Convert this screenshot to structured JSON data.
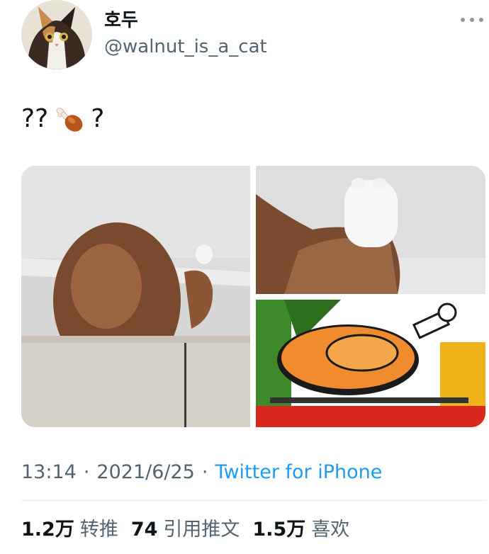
{
  "user": {
    "display_name": "호두",
    "handle": "@walnut_is_a_cat",
    "avatar_icon": "cat-avatar"
  },
  "tweet": {
    "text_before": "??",
    "emoji_icon": "poultry-leg-emoji",
    "text_after": "?"
  },
  "media": {
    "images": [
      "cat-back-photo",
      "cat-paw-closeup-photo",
      "cartoon-roast-turkey-image"
    ]
  },
  "meta": {
    "time": "13:14",
    "separator": "·",
    "date": "2021/6/25",
    "source": "Twitter for iPhone"
  },
  "stats": {
    "retweets_count": "1.2万",
    "retweets_label": "转推",
    "quotes_count": "74",
    "quotes_label": "引用推文",
    "likes_count": "1.5万",
    "likes_label": "喜欢"
  },
  "colors": {
    "text_primary": "#0f1419",
    "text_secondary": "#536471",
    "link": "#1d9bf0",
    "divider": "#e6ecf0"
  }
}
